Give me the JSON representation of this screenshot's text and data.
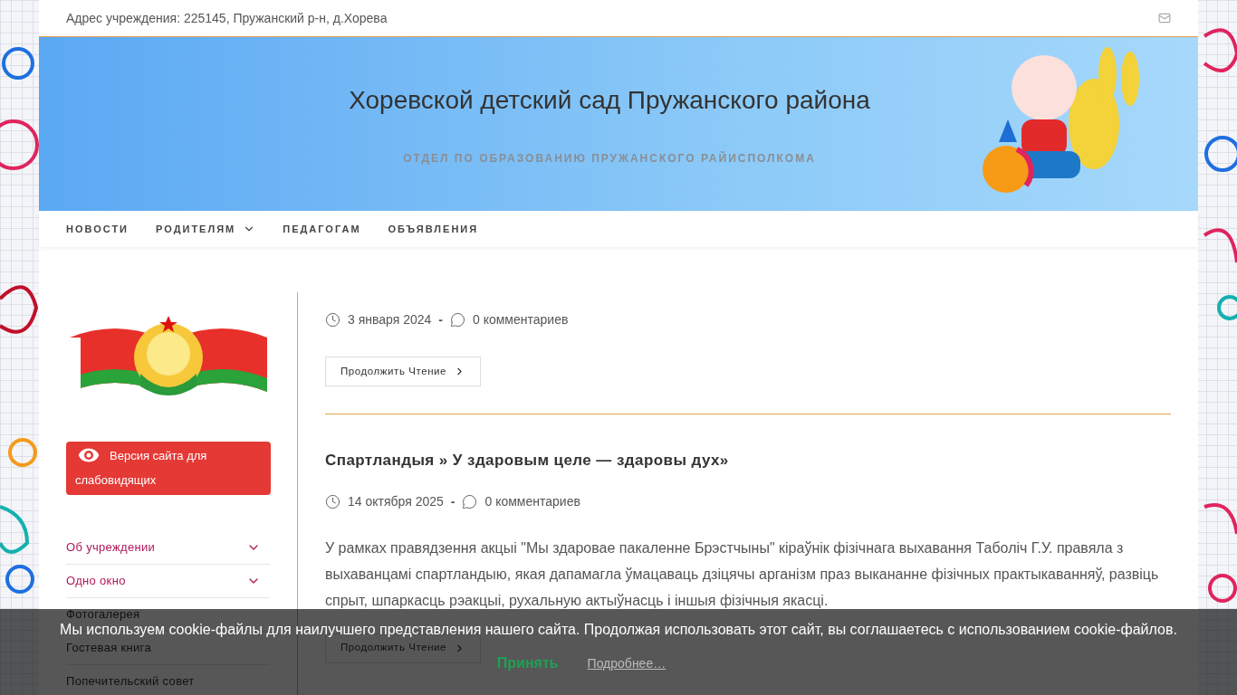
{
  "top_bar": {
    "address": "Адрес учреждения: 225145, Пружанский р-н, д.Хорева"
  },
  "header": {
    "title": "Хоревской детский сад Пружанского района",
    "subtitle": "ОТДЕЛ ПО ОБРАЗОВАНИЮ ПРУЖАНСКОГО РАЙИСПОЛКОМА"
  },
  "nav": [
    {
      "label": "НОВОСТИ",
      "has_submenu": false
    },
    {
      "label": "РОДИТЕЛЯМ",
      "has_submenu": true
    },
    {
      "label": "ПЕДАГОГАМ",
      "has_submenu": false
    },
    {
      "label": "ОБЪЯВЛЕНИЯ",
      "has_submenu": false
    }
  ],
  "sidebar": {
    "accessibility_button": "Версия сайта для слабовидящих",
    "items": [
      {
        "label": "Об учреждении",
        "kind": "submenu"
      },
      {
        "label": "Одно окно",
        "kind": "submenu"
      },
      {
        "label": "Фотогалерея",
        "kind": "link"
      },
      {
        "label": "Гостевая книга",
        "kind": "link"
      },
      {
        "label": "Попечительский совет",
        "kind": "link"
      }
    ]
  },
  "posts": [
    {
      "date": "3 января 2024",
      "separator": "-",
      "comments": "0 комментариев",
      "read_more": "Продолжить Чтение"
    },
    {
      "title": "Спартландыя » У здаровым целе — здаровы дух»",
      "date": "14 октября 2025",
      "separator": "-",
      "comments": "0 комментариев",
      "excerpt": "У рамках правядзення акцыі \"Мы здаровае пакаленне Брэстчыны\" кіраўнік фізічнага выхавання Таболіч Г.У. правяла з выхаванцамі спартландыю, якая дапамагла ўмацаваць дзіцячы арганізм праз выкананне фізічных практыкаванняў, развіць спрыт, шпаркасць рэакцыі, рухальную актыўнасць і іншыя фізічныя якасці.",
      "read_more": "Продолжить Чтение"
    }
  ],
  "cookie_bar": {
    "message": "Мы используем cookie-файлы для наилучшего представления нашего сайта. Продолжая использовать этот сайт, вы соглашаетесь с использованием cookie-файлов.",
    "accept": "Принять",
    "more": "Подробнее…"
  }
}
